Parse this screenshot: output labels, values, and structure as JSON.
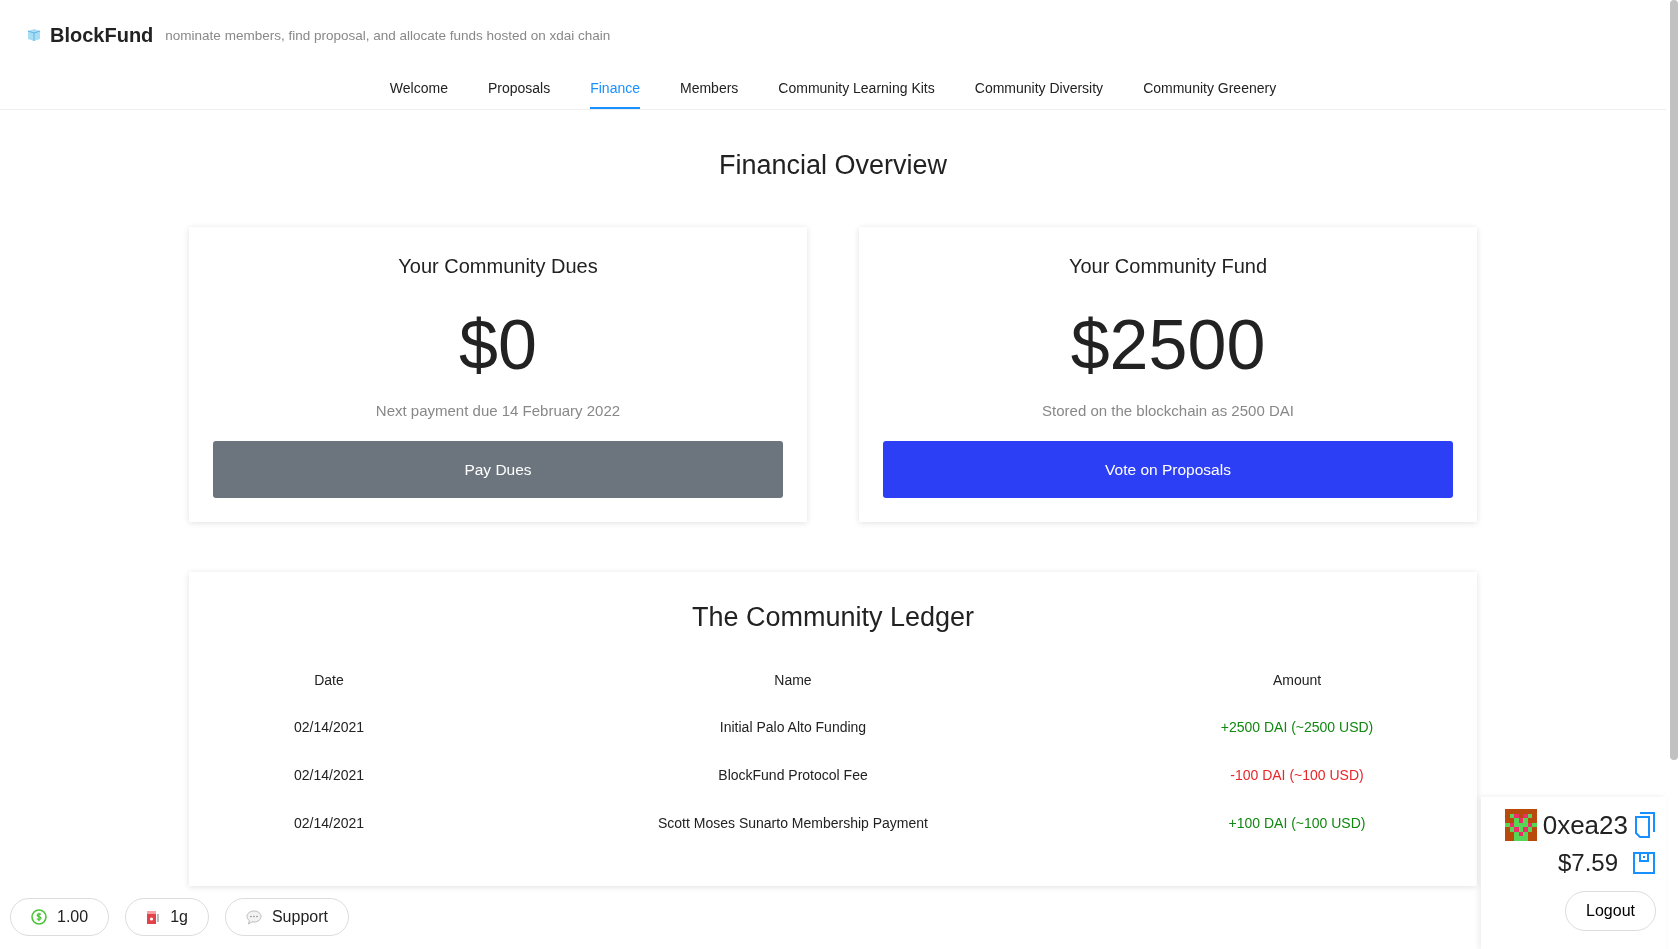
{
  "header": {
    "logo": "BlockFund",
    "tagline": "nominate members, find proposal, and allocate funds hosted on xdai chain"
  },
  "tabs": [
    {
      "label": "Welcome",
      "selected": false
    },
    {
      "label": "Proposals",
      "selected": false
    },
    {
      "label": "Finance",
      "selected": true
    },
    {
      "label": "Members",
      "selected": false
    },
    {
      "label": "Community Learning Kits",
      "selected": false
    },
    {
      "label": "Community Diversity",
      "selected": false
    },
    {
      "label": "Community Greenery",
      "selected": false
    }
  ],
  "title": "Financial Overview",
  "cards": [
    {
      "title": "Your Community Dues",
      "amount": "$0",
      "note": "Next payment due 14 February 2022",
      "button": {
        "label": "Pay Dues",
        "kind": "secondary"
      }
    },
    {
      "title": "Your Community Fund",
      "amount": "$2500",
      "note": "Stored on the blockchain as 2500 DAI",
      "button": {
        "label": "Vote on Proposals",
        "kind": "primary"
      }
    }
  ],
  "ledger": {
    "title": "The Community Ledger",
    "columns": [
      "Date",
      "Name",
      "Amount"
    ],
    "rows": [
      {
        "date": "02/14/2021",
        "name": "Initial Palo Alto Funding",
        "amount": "+2500 DAI (~2500 USD)",
        "color": "#118811"
      },
      {
        "date": "02/14/2021",
        "name": "BlockFund Protocol Fee",
        "amount": "-100 DAI (~100 USD)",
        "color": "#e8262b"
      },
      {
        "date": "02/14/2021",
        "name": "Scott Moses Sunarto Membership Payment",
        "amount": "+100 DAI (~100 USD)",
        "color": "#118811"
      }
    ]
  },
  "floating": [
    {
      "kind": "dollar",
      "label": "1.00"
    },
    {
      "kind": "gas",
      "label": "1g"
    },
    {
      "kind": "chat",
      "label": "Support"
    }
  ],
  "wallet": {
    "address": "0xea23",
    "balance": "$7.59",
    "logout": "Logout"
  }
}
